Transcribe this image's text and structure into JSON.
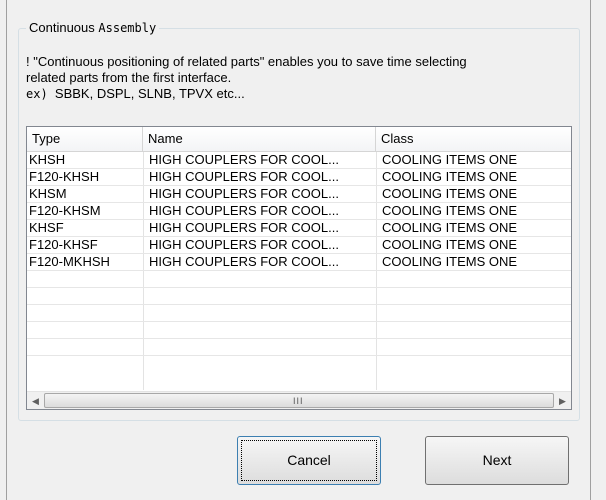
{
  "group": {
    "title_prefix": "Continuous ",
    "title_suffix": "Assembly"
  },
  "description": {
    "line1": "! \"Continuous positioning of related parts\" enables you to save time selecting",
    "line2": "related parts from the first interface.",
    "line3_prefix": "ex) ",
    "line3_rest": "SBBK, DSPL, SLNB, TPVX etc..."
  },
  "table": {
    "columns": [
      "Type",
      "Name",
      "Class"
    ],
    "rows": [
      [
        "KHSH",
        "HIGH COUPLERS FOR COOL...",
        "COOLING ITEMS ONE"
      ],
      [
        "F120-KHSH",
        "HIGH COUPLERS FOR COOL...",
        "COOLING ITEMS ONE"
      ],
      [
        "KHSM",
        "HIGH COUPLERS FOR COOL...",
        "COOLING ITEMS ONE"
      ],
      [
        "F120-KHSM",
        "HIGH COUPLERS FOR COOL...",
        "COOLING ITEMS ONE"
      ],
      [
        "KHSF",
        "HIGH COUPLERS FOR COOL...",
        "COOLING ITEMS ONE"
      ],
      [
        "F120-KHSF",
        "HIGH COUPLERS FOR COOL...",
        "COOLING ITEMS ONE"
      ],
      [
        "F120-MKHSH",
        "HIGH COUPLERS FOR COOL...",
        "COOLING ITEMS ONE"
      ]
    ],
    "empty_rows": 5,
    "scrollbar": {
      "left_arrow": "◀",
      "right_arrow": "▶",
      "grip": "III"
    }
  },
  "buttons": {
    "cancel": "Cancel",
    "next": "Next"
  }
}
